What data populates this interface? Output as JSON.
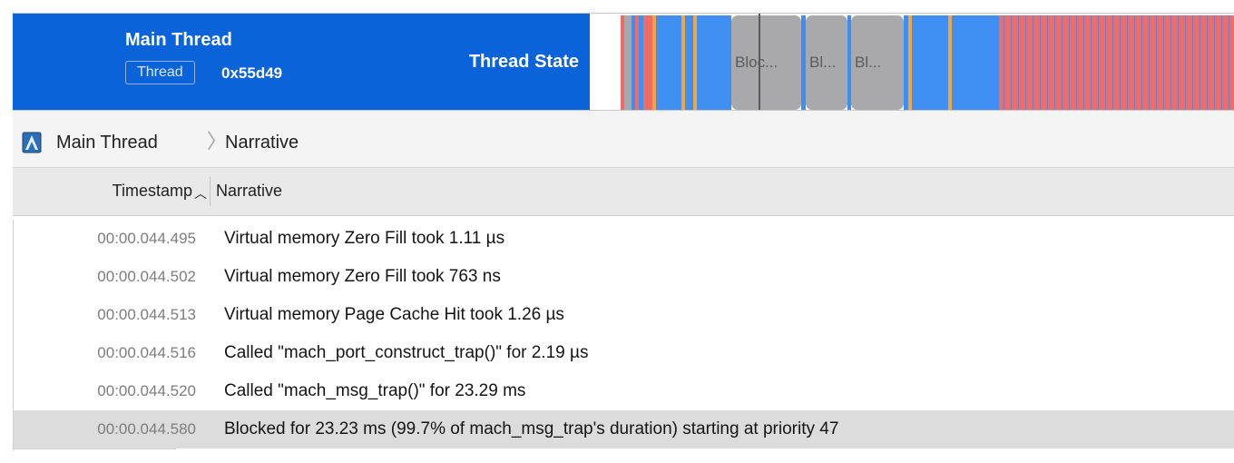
{
  "track": {
    "title": "Main Thread",
    "badge": "Thread",
    "thread_id": "0x55d49",
    "type_label": "Thread State",
    "block_labels": [
      "Bloc...",
      "Bl...",
      "Bl..."
    ],
    "colors": {
      "label_bg": "#0a63d9",
      "running": "#3f8ef2",
      "preempted": "#f2a541",
      "red_state": "#ef6b64",
      "blocked": "#a9a9ad"
    }
  },
  "breadcrumb": {
    "root": "Main Thread",
    "current": "Narrative"
  },
  "table": {
    "columns": {
      "timestamp": "Timestamp",
      "narrative": "Narrative"
    },
    "sort": "ascending",
    "rows": [
      {
        "timestamp": "00:00.044.495",
        "narrative": "Virtual memory Zero Fill took 1.11 µs"
      },
      {
        "timestamp": "00:00.044.502",
        "narrative": "Virtual memory Zero Fill took 763 ns"
      },
      {
        "timestamp": "00:00.044.513",
        "narrative": "Virtual memory Page Cache Hit took 1.26 µs"
      },
      {
        "timestamp": "00:00.044.516",
        "narrative": "Called \"mach_port_construct_trap()\" for 2.19 µs"
      },
      {
        "timestamp": "00:00.044.520",
        "narrative": "Called \"mach_msg_trap()\" for 23.29 ms"
      },
      {
        "timestamp": "00:00.044.580",
        "narrative": "Blocked for 23.23 ms (99.7% of mach_msg_trap's duration) starting at priority 47"
      }
    ]
  }
}
